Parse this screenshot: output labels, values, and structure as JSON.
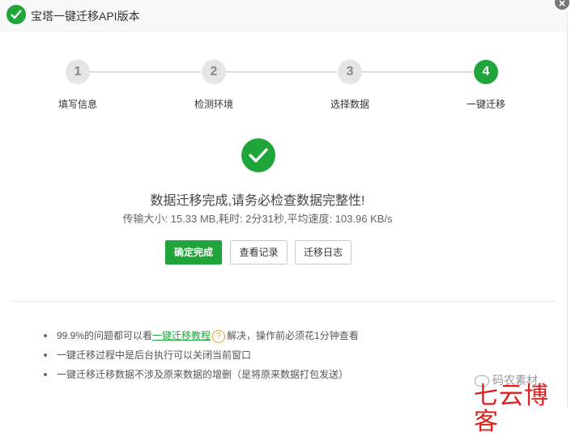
{
  "window": {
    "title": "宝塔一键迁移API版本"
  },
  "steps": [
    {
      "number": "1",
      "label": "填写信息",
      "active": false
    },
    {
      "number": "2",
      "label": "检测环境",
      "active": false
    },
    {
      "number": "3",
      "label": "选择数据",
      "active": false
    },
    {
      "number": "4",
      "label": "一键迁移",
      "active": true
    }
  ],
  "result": {
    "title": "数据迁移完成,请务必检查数据完整性!",
    "stats": "传输大小: 15.33 MB,耗时: 2分31秒,平均速度: 103.96 KB/s"
  },
  "buttons": {
    "confirm": "确定完成",
    "view_records": "查看记录",
    "migration_log": "迁移日志"
  },
  "tips": {
    "tip1_prefix": "99.9%的问题都可以看",
    "tip1_link": "一键迁移教程",
    "tip1_help": "?",
    "tip1_suffix": "解决，操作前必须花1分钟查看",
    "tip2": "一键迁移过程中是后台执行可以关闭当前窗口",
    "tip3": "一键迁移迁移数据不涉及原来数据的增删（是将原来数据打包发送）"
  },
  "watermark": {
    "small": "码农素材",
    "large": "七云博客"
  },
  "colors": {
    "accent": "#20a53a",
    "watermark_red": "#e02020"
  }
}
